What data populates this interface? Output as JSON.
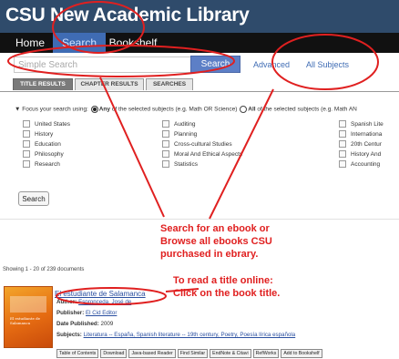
{
  "header": {
    "title": "CSU New Academic Library"
  },
  "nav": {
    "items": [
      {
        "label": "Home",
        "active": false
      },
      {
        "label": "Search",
        "active": true
      },
      {
        "label": "Bookshelf",
        "active": false
      }
    ]
  },
  "search": {
    "placeholder": "Simple Search",
    "button_label": "Search",
    "advanced_label": "Advanced",
    "subjects_label": "All Subjects"
  },
  "tabs": [
    {
      "label": "TITLE RESULTS",
      "active": true
    },
    {
      "label": "CHAPTER RESULTS",
      "active": false
    },
    {
      "label": "SEARCHES",
      "active": false
    }
  ],
  "focus": {
    "prefix": "Focus your search using:",
    "any_label": "Any",
    "any_suffix": "of the selected subjects (e.g. Math OR Science)",
    "all_label": "All",
    "all_suffix": "of the selected subjects (e.g. Math AN"
  },
  "subjects": {
    "col1": [
      "United States",
      "History",
      "Education",
      "Philosophy",
      "Research"
    ],
    "col2": [
      "Auditing",
      "Planning",
      "Cross-cultural Studies",
      "Moral And Ethical Aspects",
      "Statistics"
    ],
    "col3": [
      "Spanish Lite",
      "Internationa",
      "20th Centur",
      "History And",
      "Accounting"
    ]
  },
  "bottom_search_label": "Search",
  "results": {
    "showing": "Showing 1 - 20 of 239 documents",
    "book": {
      "title": "El estudiante de Salamanca",
      "cover_text": "El estudiante de Salamanca",
      "author_label": "Author:",
      "author": "Espronceda, José de",
      "publisher_label": "Publisher:",
      "publisher": "El Cid Editor",
      "date_label": "Date Published:",
      "date": "2009",
      "subjects_label": "Subjects:",
      "subjects": "Literatura -- España,  Spanish literature -- 19th century,  Poetry,  Poesía lírica española"
    },
    "actions": [
      "Table of Contents",
      "Download",
      "Java-based Reader",
      "Find Similar",
      "EndNote & Citavi",
      "RefWorks",
      "Add to Bookshelf"
    ]
  },
  "annotations": {
    "search_note": [
      "Search for an ebook or",
      "Browse all ebooks CSU",
      "purchased in ebrary."
    ],
    "read_note": [
      "To read a title online:",
      "Click on the book title."
    ]
  },
  "colors": {
    "header_bg": "#2f4b6b",
    "nav_bg": "#111111",
    "nav_active": "#3f6cb4",
    "search_button": "#5d7fc6",
    "annotation": "#e02020",
    "link": "#2a4fa0"
  },
  "icons": {
    "focus_bullet": "triangle-down-icon"
  }
}
